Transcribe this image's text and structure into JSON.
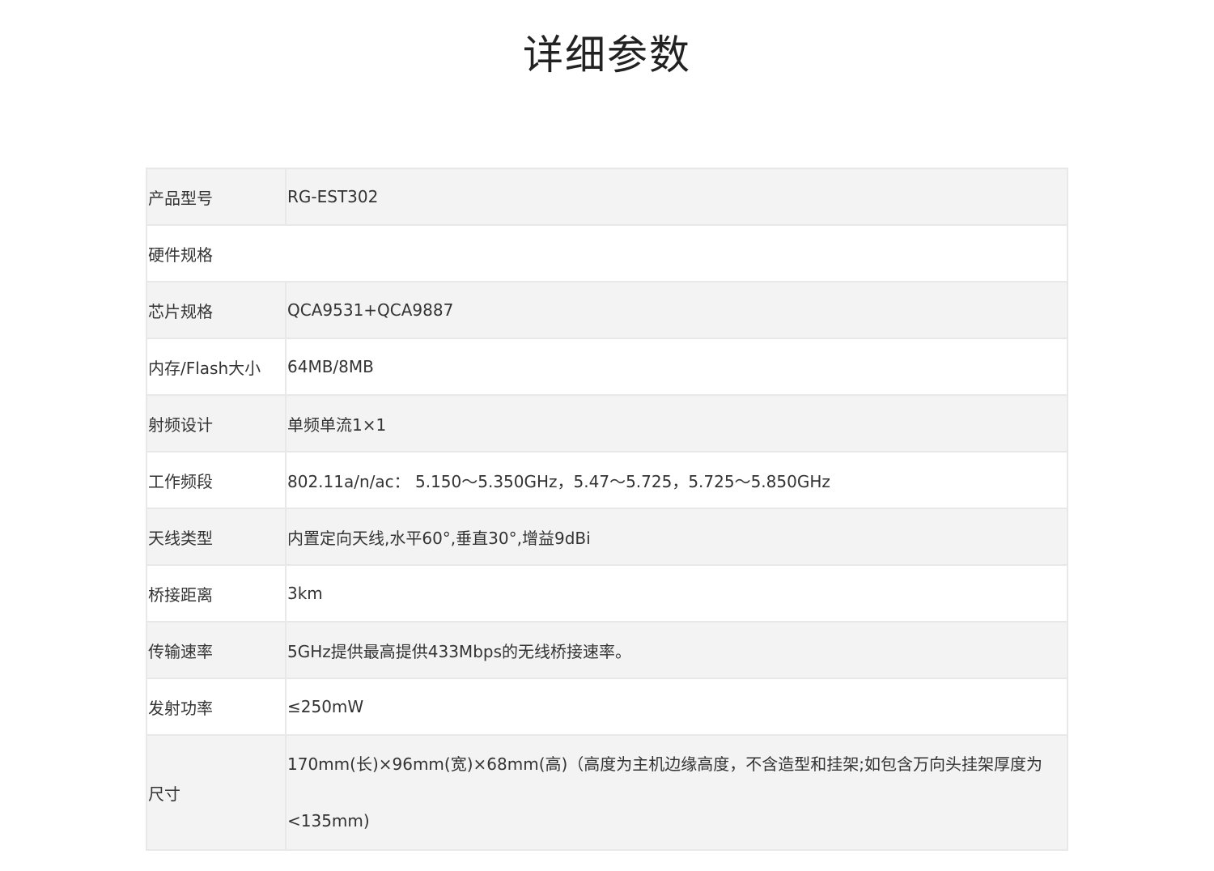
{
  "page": {
    "title": "详细参数"
  },
  "specs": {
    "rows": [
      {
        "label": "产品型号",
        "value": "RG-EST302"
      },
      {
        "label": "硬件规格",
        "value": ""
      },
      {
        "label": "芯片规格",
        "value": "QCA9531+QCA9887"
      },
      {
        "label": "内存/Flash大小",
        "value": "64MB/8MB"
      },
      {
        "label": "射频设计",
        "value": "单频单流1×1"
      },
      {
        "label": "工作频段",
        "value": "802.11a/n/ac： 5.150～5.350GHz，5.47～5.725，5.725～5.850GHz"
      },
      {
        "label": "天线类型",
        "value": "内置定向天线,水平60°,垂直30°,增益9dBi"
      },
      {
        "label": "桥接距离",
        "value": "3km"
      },
      {
        "label": "传输速率",
        "value": "5GHz提供最高提供433Mbps的无线桥接速率。"
      },
      {
        "label": "发射功率",
        "value": "≤250mW"
      },
      {
        "label": "尺寸",
        "value_line1": "170mm(长)×96mm(宽)×68mm(高)（高度为主机边缘高度，不含造型和挂架;如包含万向头挂架厚度为",
        "value_line2": "<135mm)"
      }
    ]
  }
}
